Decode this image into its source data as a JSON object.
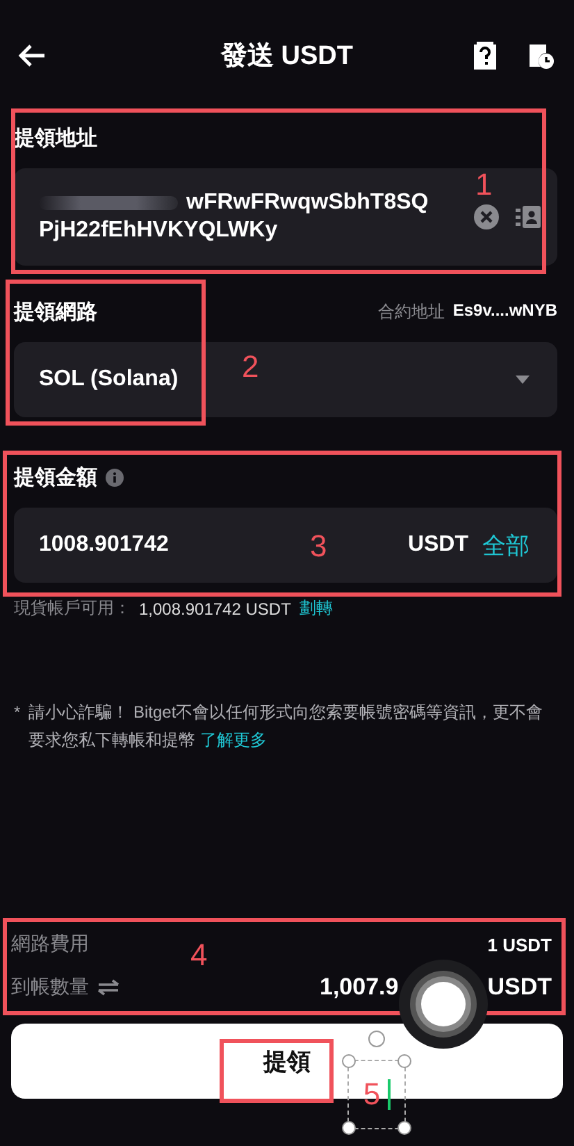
{
  "header": {
    "title": "發送 USDT"
  },
  "address": {
    "label": "提領地址",
    "lines": [
      "wFRwFRwqwSbhT8SQ",
      "PjH22fEhHVKYQLWKy"
    ],
    "redacted": true
  },
  "network": {
    "label": "提領網路",
    "contract_label": "合約地址",
    "contract": "Es9v....wNYB",
    "value": "SOL (Solana)"
  },
  "amount": {
    "label": "提領金額",
    "value": "1008.901742",
    "unit": "USDT",
    "max_link": "全部"
  },
  "balance": {
    "label": "現貨帳戶可用：",
    "value": "1,008.901742 USDT",
    "link": "劃轉"
  },
  "warning": {
    "mark": "*",
    "text": "請小心詐騙！ Bitget不會以任何形式向您索要帳號密碼等資訊，更不會要求您私下轉帳和提幣",
    "link": "了解更多"
  },
  "summary": {
    "fee_label": "網路費用",
    "fee": "1 USDT",
    "receive_label": "到帳數量",
    "receive": "1,007.9",
    "receive_unit": "USDT"
  },
  "submit": {
    "label": "提領"
  },
  "annotations": [
    {
      "label": "1"
    },
    {
      "label": "2"
    },
    {
      "label": "3"
    },
    {
      "label": "4"
    },
    {
      "label": "5"
    }
  ]
}
